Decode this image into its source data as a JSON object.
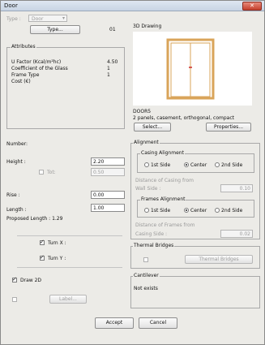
{
  "window": {
    "title": "Door",
    "close_glyph": "✕"
  },
  "type_section": {
    "type_label": "Type :",
    "type_value": "Door",
    "type_button": "Type...",
    "type_code": "01"
  },
  "attributes": {
    "title": "Attributes",
    "rows": [
      {
        "label": "U Factor (Kcal/m²hc)",
        "value": "4.50"
      },
      {
        "label": "Coefficient of the Glass",
        "value": "1"
      },
      {
        "label": "Frame Type",
        "value": "1"
      },
      {
        "label": "Cost (€)",
        "value": ""
      }
    ]
  },
  "drawing": {
    "title": "3D Drawing",
    "name": "DOOR5",
    "description": "2 panels, casement, orthogonal, compact",
    "select_button": "Select...",
    "properties_button": "Properties..."
  },
  "left_fields": {
    "number_label": "Number:",
    "height_label": "Height :",
    "height_value": "2.20",
    "tot_label": "Tot:",
    "tot_value": "0.50",
    "rise_label": "Rise :",
    "rise_value": "0.00",
    "length_label": "Length :",
    "length_value": "1.00",
    "proposed_length": "Proposed Length : 1.29",
    "turn_x": "Turn X :",
    "turn_y": "Turn Y :",
    "draw_2d": "Draw 2D",
    "label_button": "Label..."
  },
  "alignment": {
    "title": "Alignment",
    "casing_title": "Casing Alignment",
    "casing_options": [
      "1st Side",
      "Center",
      "2nd Side"
    ],
    "distance_casing": "Distance of Casing from",
    "wall_side": "Wall Side :",
    "wall_side_value": "0.10",
    "frames_title": "Frames Alignment",
    "frames_options": [
      "1st Side",
      "Center",
      "2nd Side"
    ],
    "distance_frames": "Distance of Frames from",
    "casing_side": "Casing Side :",
    "casing_side_value": "0.02"
  },
  "thermal": {
    "title": "Thermal Bridges",
    "button": "Thermal Bridges"
  },
  "cantilever": {
    "title": "Cantilever",
    "status": "Not exists"
  },
  "footer": {
    "accept": "Accept",
    "cancel": "Cancel"
  },
  "colors": {
    "door_frame": "#d9a45a",
    "door_handle": "#cc2b2b",
    "title_bar": "#c8d4e4"
  }
}
